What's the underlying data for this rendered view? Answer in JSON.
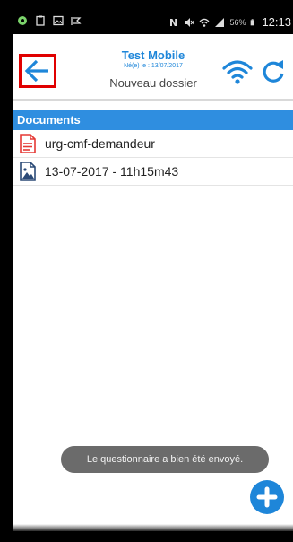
{
  "status_bar": {
    "battery": "56%",
    "time": "12:13",
    "left_icons": [
      "app-icon",
      "clipboard-icon",
      "image-icon",
      "checkmark-flag-icon"
    ],
    "right_icons": [
      "nfc-icon",
      "mute-icon",
      "wifi-icon",
      "signal-icon",
      "battery-icon"
    ]
  },
  "header": {
    "title": "Test Mobile",
    "created_date": "Né(e) le : 13/07/2017",
    "folder_name": "Nouveau dossier",
    "back_icon": "arrow-left-icon",
    "wifi_icon": "wifi-icon",
    "refresh_icon": "refresh-icon"
  },
  "documents": {
    "section_title": "Documents",
    "items": [
      {
        "label": "urg-cmf-demandeur",
        "icon": "pdf-document-icon",
        "color": "#e53935"
      },
      {
        "label": "13-07-2017 - 11h15m43",
        "icon": "image-document-icon",
        "color": "#2b4a77"
      }
    ]
  },
  "toast": {
    "message": "Le questionnaire a bien été envoyé."
  },
  "fab": {
    "icon": "plus-icon"
  },
  "colors": {
    "accent": "#1e86d9",
    "section_header": "#2f8ee0",
    "back_highlight": "#e00000",
    "toast_bg": "#6b6b6b"
  }
}
